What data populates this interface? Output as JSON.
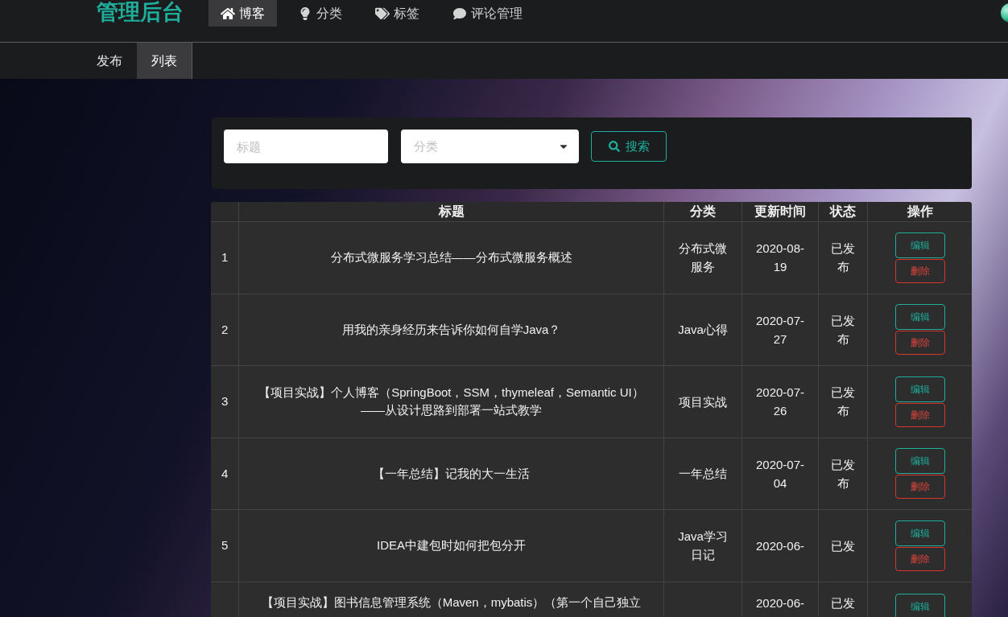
{
  "header": {
    "logo": "管理后台",
    "nav": [
      {
        "label": "博客",
        "selected": true
      },
      {
        "label": "分类",
        "selected": false
      },
      {
        "label": "标签",
        "selected": false
      },
      {
        "label": "评论管理",
        "selected": false
      }
    ]
  },
  "subnav": [
    {
      "label": "发布",
      "selected": false
    },
    {
      "label": "列表",
      "selected": true
    }
  ],
  "search": {
    "title_field": {
      "placeholder": "标题"
    },
    "category_select": {
      "placeholder": "分类"
    },
    "button": "搜索"
  },
  "table": {
    "columns": [
      "标题",
      "分类",
      "更新时间",
      "状态",
      "操作"
    ],
    "rows": [
      {
        "kind": "full",
        "number": "1",
        "title": "分布式微服务学习总结——分布式微服务概述",
        "category": "分布式微服务",
        "updated": "2020-08-19",
        "status": "已发布",
        "actions": [
          {
            "kind": "edit",
            "label": "编辑"
          },
          {
            "kind": "delete",
            "label": "删除"
          }
        ]
      },
      {
        "kind": "full",
        "number": "2",
        "title": "用我的亲身经历来告诉你如何自学Java？",
        "category": "Java心得",
        "updated": "2020-07-27",
        "status": "已发布",
        "actions": [
          {
            "kind": "edit",
            "label": "编辑"
          },
          {
            "kind": "delete",
            "label": "删除"
          }
        ]
      },
      {
        "kind": "full",
        "number": "3",
        "title": "【项目实战】个人博客（SpringBoot，SSM，thymeleaf，Semantic UI）——从设计思路到部署一站式教学",
        "category": "项目实战",
        "updated": "2020-07-26",
        "status": "已发布",
        "actions": [
          {
            "kind": "edit",
            "label": "编辑"
          },
          {
            "kind": "delete",
            "label": "删除"
          }
        ]
      },
      {
        "kind": "full",
        "number": "4",
        "title": "【一年总结】记我的大一生活",
        "category": "一年总结",
        "updated": "2020-07-04",
        "status": "已发布",
        "actions": [
          {
            "kind": "edit",
            "label": "编辑"
          },
          {
            "kind": "delete",
            "label": "删除"
          }
        ]
      },
      {
        "kind": "full",
        "number": "5",
        "title": "IDEA中建包时如何把包分开",
        "category": "Java学习日记",
        "updated": "2020-06-",
        "status": "已发",
        "actions": [
          {
            "kind": "edit",
            "label": "编辑"
          },
          {
            "kind": "delete",
            "label": "删除"
          }
        ]
      },
      {
        "kind": "cut",
        "title": "【项目实战】图书信息管理系统（Maven，mybatis）（第一个自己独立",
        "updated": "2020-06-",
        "status": "已发",
        "actions": [
          {
            "kind": "edit",
            "label": "编辑"
          }
        ]
      }
    ]
  }
}
